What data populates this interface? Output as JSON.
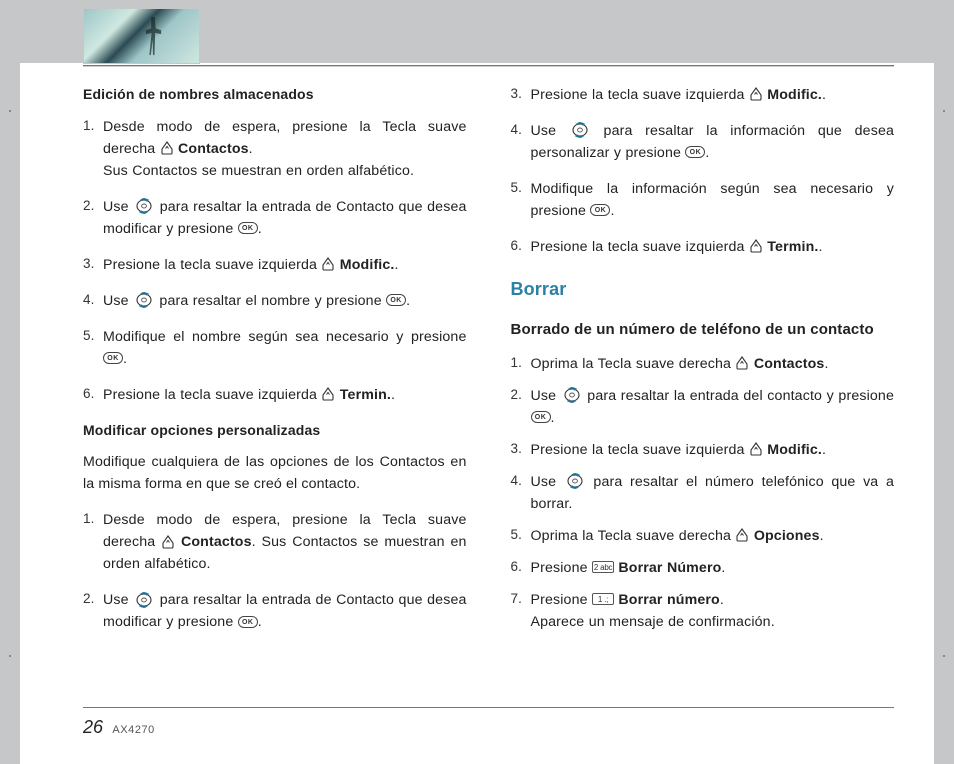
{
  "page": {
    "number": "26",
    "model": "AX4270"
  },
  "icon_labels": {
    "ok": "OK"
  },
  "sec1": {
    "title": "Edición de nombres almacenados",
    "s1a": "Desde modo de espera, presione la Tecla suave derecha ",
    "s1b": " Contactos",
    "s1c": ".",
    "s1d": "Sus Contactos se muestran en orden alfabético.",
    "s2a": "Use ",
    "s2b": " para resaltar la entrada de Contacto que desea modificar y presione ",
    "s2c": ".",
    "s3a": "Presione la tecla suave izquierda ",
    "s3b": " Modific.",
    "s3c": ".",
    "s4a": "Use ",
    "s4b": " para resaltar el nombre y presione ",
    "s4c": ".",
    "s5a": "Modifique el nombre según sea necesario y presione ",
    "s5b": ".",
    "s6a": " Presione la tecla suave izquierda ",
    "s6b": " Termin.",
    "s6c": "."
  },
  "sec2": {
    "title": "Modificar opciones personalizadas",
    "intro": "Modifique cualquiera de las opciones de los Contactos en la misma forma en que se creó el contacto.",
    "s1a": "Desde modo de espera, presione la Tecla suave derecha ",
    "s1b": " Contactos",
    "s1c": ".  Sus Contactos se muestran en orden alfabético.",
    "s2a": "Use ",
    "s2b": " para resaltar la entrada de Contacto que desea modificar y presione ",
    "s2c": ".",
    "s3a": "Presione la tecla suave izquierda ",
    "s3b": " Modific.",
    "s3c": ".",
    "s4a": "Use ",
    "s4b": " para resaltar la información que desea personalizar y presione ",
    "s4c": ".",
    "s5a": "Modifique la información según sea necesario y presione ",
    "s5b": ".",
    "s6a": "Presione la tecla suave izquierda ",
    "s6b": " Termin.",
    "s6c": "."
  },
  "sec3": {
    "heading": "Borrar",
    "title": "Borrado de un número de teléfono de un contacto",
    "s1a": "Oprima la Tecla suave derecha ",
    "s1b": " Contactos",
    "s1c": ".",
    "s2a": "Use ",
    "s2b": " para resaltar la entrada del contacto y presione ",
    "s2c": ".",
    "s3a": "Presione la tecla suave izquierda ",
    "s3b": " Modific.",
    "s3c": ".",
    "s4a": "Use ",
    "s4b": " para resaltar el número telefónico que va a borrar.",
    "s5a": "Oprima la Tecla suave derecha ",
    "s5b": " Opciones",
    "s5c": ".",
    "s6a": "Presione ",
    "s6key": "2 abc",
    "s6b": " Borrar Número",
    "s6c": ".",
    "s7a": "Presione ",
    "s7key": "1 .;",
    "s7b": " Borrar número",
    "s7c": ".",
    "s7d": "Aparece un mensaje de confirmación."
  }
}
